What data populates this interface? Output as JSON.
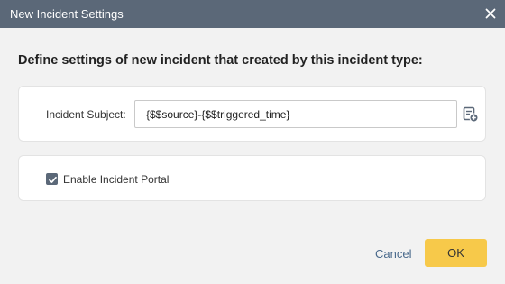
{
  "dialog": {
    "title": "New Incident Settings",
    "close_icon": "close-icon",
    "heading": "Define settings of new incident that created by this incident type:"
  },
  "subject": {
    "label": "Incident Subject:",
    "value": "{$$source}-{$$triggered_time}",
    "insert_icon": "insert-variable-icon"
  },
  "portal": {
    "label": "Enable Incident Portal",
    "checked": true
  },
  "footer": {
    "cancel_label": "Cancel",
    "ok_label": "OK"
  },
  "colors": {
    "titlebar": "#5b6878",
    "background": "#f2f2f2",
    "ok_button": "#f7c94a",
    "link": "#4a6a8c"
  }
}
